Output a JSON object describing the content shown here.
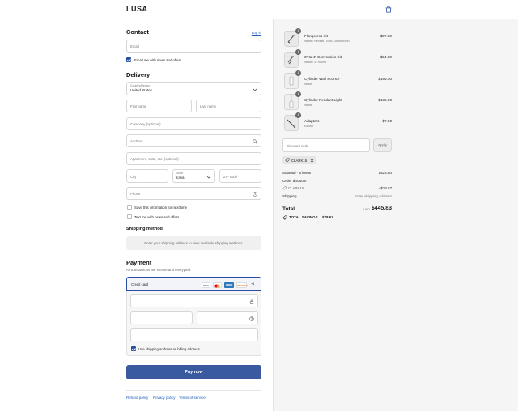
{
  "header": {
    "logo": "LUSA",
    "cart_icon": "shopping-bag-icon"
  },
  "contact": {
    "title": "Contact",
    "login_link": "Log in",
    "email_placeholder": "Email",
    "email_news_label": "Email me with news and offers",
    "email_news_checked": true
  },
  "delivery": {
    "title": "Delivery",
    "country_label": "Country/Region",
    "country_value": "United States",
    "first_name_ph": "First name",
    "last_name_ph": "Last name",
    "company_ph": "Company (optional)",
    "address_ph": "Address",
    "apartment_ph": "Apartment, suite, etc. (optional)",
    "city_ph": "City",
    "state_label": "State",
    "state_value": "Iowa",
    "zip_ph": "ZIP code",
    "phone_ph": "Phone",
    "save_info_label": "Save this information for next time",
    "text_news_label": "Text me with news and offers"
  },
  "shipping": {
    "title": "Shipping method",
    "notice": "Enter your shipping address to view available shipping methods."
  },
  "payment": {
    "title": "Payment",
    "subtitle": "All transactions are secure and encrypted.",
    "method_label": "Credit card",
    "cards": [
      "VISA",
      "MC",
      "AMEX",
      "DISCOVER"
    ],
    "more_cards": "+1",
    "billing_label": "Use shipping address as billing address",
    "billing_checked": true,
    "pay_button": "Pay now"
  },
  "footer": {
    "refund": "Refund policy",
    "privacy": "Privacy policy",
    "terms": "Terms of service"
  },
  "order": {
    "items": [
      {
        "qty": "1",
        "name": "Flangeless Kit",
        "variant": "White / Recess / New Construction",
        "price": "$87.50"
      },
      {
        "qty": "1",
        "name": "6\" to 4\" Conversion Kit",
        "variant": "White / 4\" Round",
        "price": "$84.00"
      },
      {
        "qty": "1",
        "name": "Cylinder Wall Sconce",
        "variant": "White",
        "price": "$165.00"
      },
      {
        "qty": "1",
        "name": "Cylinder Pendant Light",
        "variant": "White",
        "price": "$186.00"
      },
      {
        "qty": "1",
        "name": "Adapters",
        "variant": "Edison",
        "price": "$7.00"
      }
    ],
    "discount_placeholder": "Discount code",
    "apply_button": "Apply",
    "applied_code": "CLARK15",
    "subtotal_label": "Subtotal · 5 items",
    "subtotal_value": "$524.50",
    "order_discount_label": "Order discount",
    "discount_code_label": "CLARK15",
    "discount_value": "- $78.67",
    "shipping_label": "Shipping",
    "shipping_value": "Enter shipping address",
    "total_label": "Total",
    "currency": "USD",
    "total_value": "$445.83",
    "savings_label": "TOTAL SAVINGS",
    "savings_value": "$78.67"
  },
  "colors": {
    "accent": "#3a5aa0",
    "link": "#1f5fbf",
    "sidebar_bg": "#f5f5f5"
  }
}
